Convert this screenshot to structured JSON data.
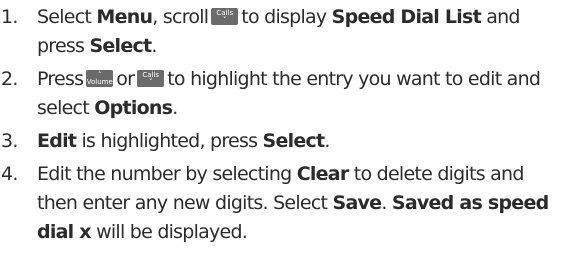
{
  "steps": [
    {
      "num": "1.",
      "parts": [
        {
          "t": "Select "
        },
        {
          "t": "Menu",
          "bold": true
        },
        {
          "t": ", scroll"
        },
        {
          "key": {
            "label": "Calls",
            "arrow": "down",
            "icon": "calls-down-key-icon"
          }
        },
        {
          "t": "to display "
        },
        {
          "t": "Speed Dial List",
          "bold": true
        },
        {
          "t": " and press "
        },
        {
          "t": "Select",
          "bold": true
        },
        {
          "t": "."
        }
      ]
    },
    {
      "num": "2.",
      "parts": [
        {
          "t": "Press"
        },
        {
          "key": {
            "label": "Volume",
            "arrow": "up",
            "icon": "volume-up-key-icon"
          }
        },
        {
          "t": "or"
        },
        {
          "key": {
            "label": "Calls",
            "arrow": "down",
            "icon": "calls-down-key-icon"
          }
        },
        {
          "t": "to highlight the entry you want to edit and select "
        },
        {
          "t": "Options",
          "bold": true
        },
        {
          "t": "."
        }
      ]
    },
    {
      "num": "3.",
      "parts": [
        {
          "t": "Edit",
          "bold": true
        },
        {
          "t": " is highlighted, press "
        },
        {
          "t": "Select",
          "bold": true
        },
        {
          "t": "."
        }
      ]
    },
    {
      "num": "4.",
      "parts": [
        {
          "t": "Edit the number by selecting "
        },
        {
          "t": "Clear",
          "bold": true
        },
        {
          "t": " to delete digits and then enter any new digits. Select "
        },
        {
          "t": "Save",
          "bold": true
        },
        {
          "t": ". "
        },
        {
          "t": "Saved as speed dial x",
          "bold": true
        },
        {
          "t": " will be displayed."
        }
      ]
    }
  ]
}
